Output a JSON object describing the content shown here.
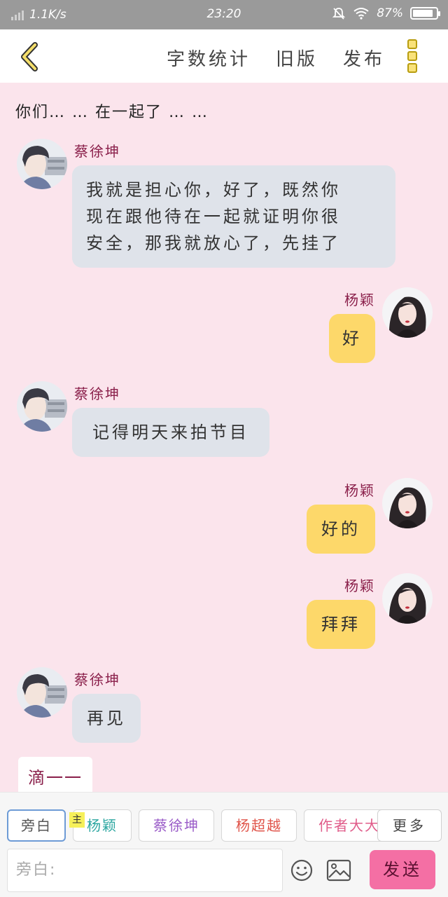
{
  "status_bar": {
    "speed": "1.1K/s",
    "time": "23:20",
    "battery": "87%",
    "battery_fraction": 0.87,
    "icons": [
      "signal-icon",
      "mute-icon",
      "wifi-icon",
      "battery-icon"
    ]
  },
  "top_bar": {
    "back_icon": "chevron-left-icon",
    "word_count": "字数统计",
    "old_version": "旧版",
    "publish": "发布",
    "more_icon": "more-vertical-icon",
    "accent": "#f4de6a"
  },
  "chat": {
    "top_narration": "你们… … 在一起了 … …",
    "messages": [
      {
        "side": "left",
        "name": "蔡徐坤",
        "lines": [
          "我就是担心你，好了，既然你",
          "现在跟他待在一起就证明你很",
          "安全，那我就放心了，先挂了"
        ]
      },
      {
        "side": "right",
        "name": "杨颖",
        "lines": [
          "好"
        ]
      },
      {
        "side": "left",
        "name": "蔡徐坤",
        "lines": [
          "记得明天来拍节目"
        ]
      },
      {
        "side": "right",
        "name": "杨颖",
        "lines": [
          "好的"
        ]
      },
      {
        "side": "right",
        "name": "杨颖",
        "lines": [
          "拜拜"
        ]
      },
      {
        "side": "left",
        "name": "蔡徐坤",
        "lines": [
          "再见"
        ]
      }
    ],
    "drip_text": "滴一一",
    "colors": {
      "background": "#fbe4ec",
      "left_bubble": "#dfe3ea",
      "right_bubble": "#fdd86a",
      "name": "#8a1f4a"
    }
  },
  "bottom": {
    "chips": [
      {
        "label": "旁白",
        "color": "#555555",
        "active": true
      },
      {
        "label": "杨颖",
        "color": "#2ba6a0",
        "active": false
      },
      {
        "label": "蔡徐坤",
        "color": "#9a5cc8",
        "active": false
      },
      {
        "label": "杨超越",
        "color": "#e0554b",
        "active": false
      },
      {
        "label": "作者大大",
        "color": "#e05c8a",
        "active": false
      }
    ],
    "host_badge": "主",
    "more_label": "更多",
    "input_placeholder": "旁白:",
    "send_label": "发送",
    "send_color": "#f46fa4",
    "icons": [
      "emoji-icon",
      "image-icon"
    ]
  }
}
